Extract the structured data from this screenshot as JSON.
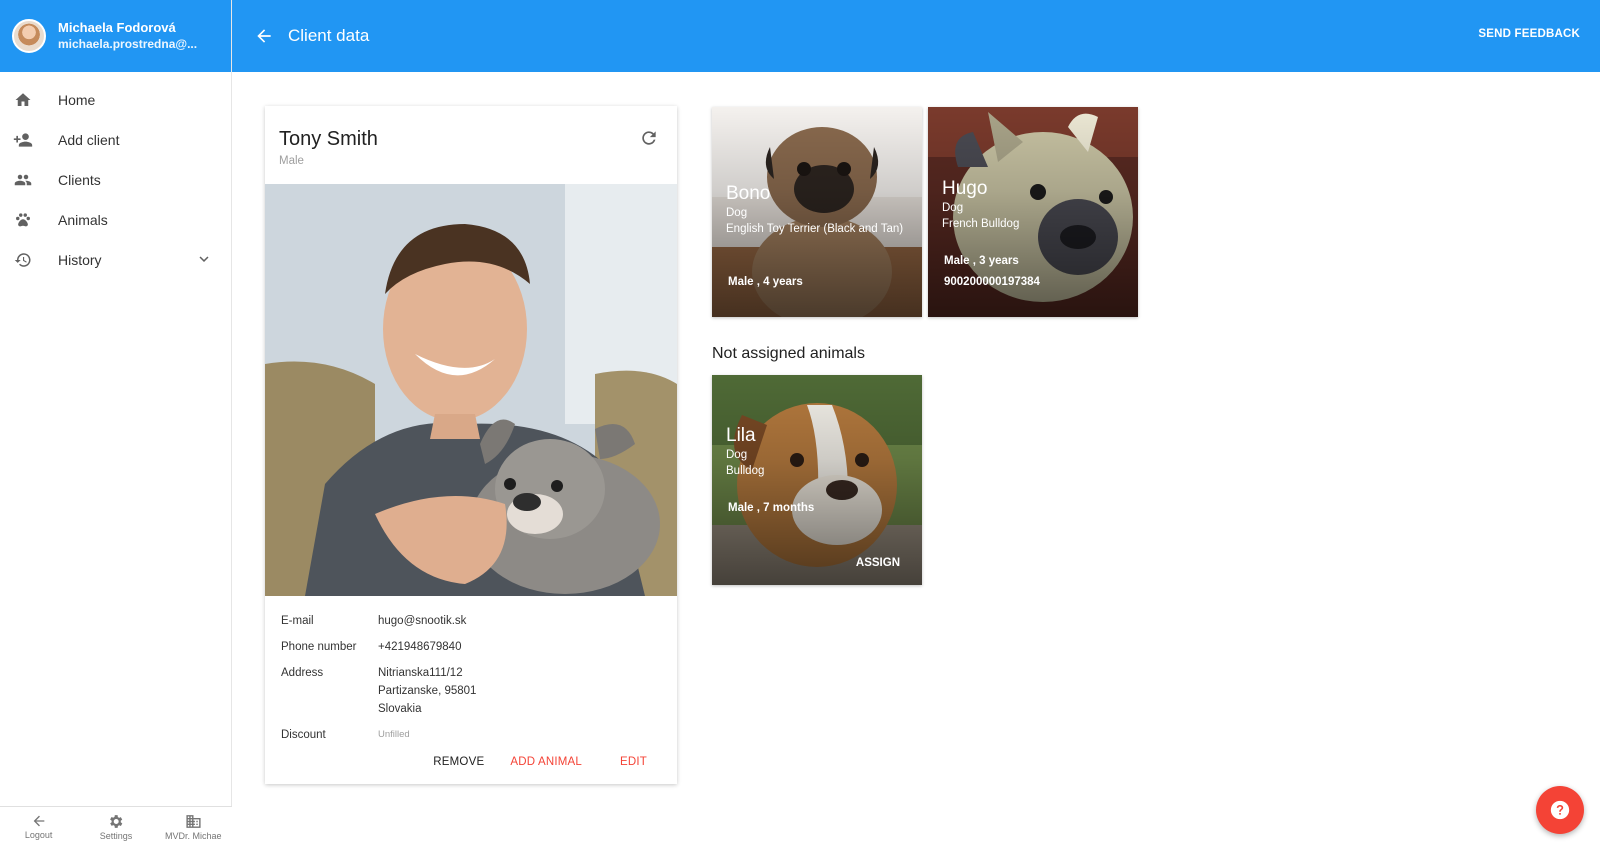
{
  "user": {
    "name": "Michaela Fodorová",
    "email": "michaela.prostredna@..."
  },
  "nav": {
    "home": "Home",
    "add_client": "Add client",
    "clients": "Clients",
    "animals": "Animals",
    "history": "History"
  },
  "bottom": {
    "logout": "Logout",
    "settings": "Settings",
    "clinic": "MVDr. Michae"
  },
  "appbar": {
    "title": "Client data",
    "feedback": "SEND FEEDBACK"
  },
  "client": {
    "name": "Tony Smith",
    "gender": "Male",
    "email_label": "E-mail",
    "email": "hugo@snootik.sk",
    "phone_label": "Phone number",
    "phone": "+421948679840",
    "address_label": "Address",
    "address_1": "Nitrianska111/12",
    "address_2": "Partizanske, 95801",
    "address_3": "Slovakia",
    "discount_label": "Discount",
    "discount": "Unfilled",
    "actions": {
      "remove": "REMOVE",
      "add_animal": "ADD ANIMAL",
      "edit": "EDIT"
    }
  },
  "animals": [
    {
      "name": "Bono",
      "species": "Dog",
      "breed": "English Toy Terrier (Black and Tan)",
      "gender_age": "Male , 4 years"
    },
    {
      "name": "Hugo",
      "species": "Dog",
      "breed": "French Bulldog",
      "gender_age": "Male , 3 years",
      "chip": "900200000197384"
    }
  ],
  "not_assigned": {
    "title": "Not assigned animals",
    "animals": [
      {
        "name": "Lila",
        "species": "Dog",
        "breed": "Bulldog",
        "gender_age": "Male , 7 months",
        "action": "ASSIGN"
      }
    ]
  },
  "colors": {
    "primary": "#2196f3",
    "accent": "#f44336"
  },
  "icons": {
    "home": "home-icon",
    "add_client": "person-add-icon",
    "clients": "people-icon",
    "animals": "paw-icon",
    "history": "history-icon",
    "logout": "arrow-back-icon",
    "settings": "gear-icon",
    "clinic": "building-icon",
    "refresh": "refresh-icon",
    "help": "help-icon"
  }
}
